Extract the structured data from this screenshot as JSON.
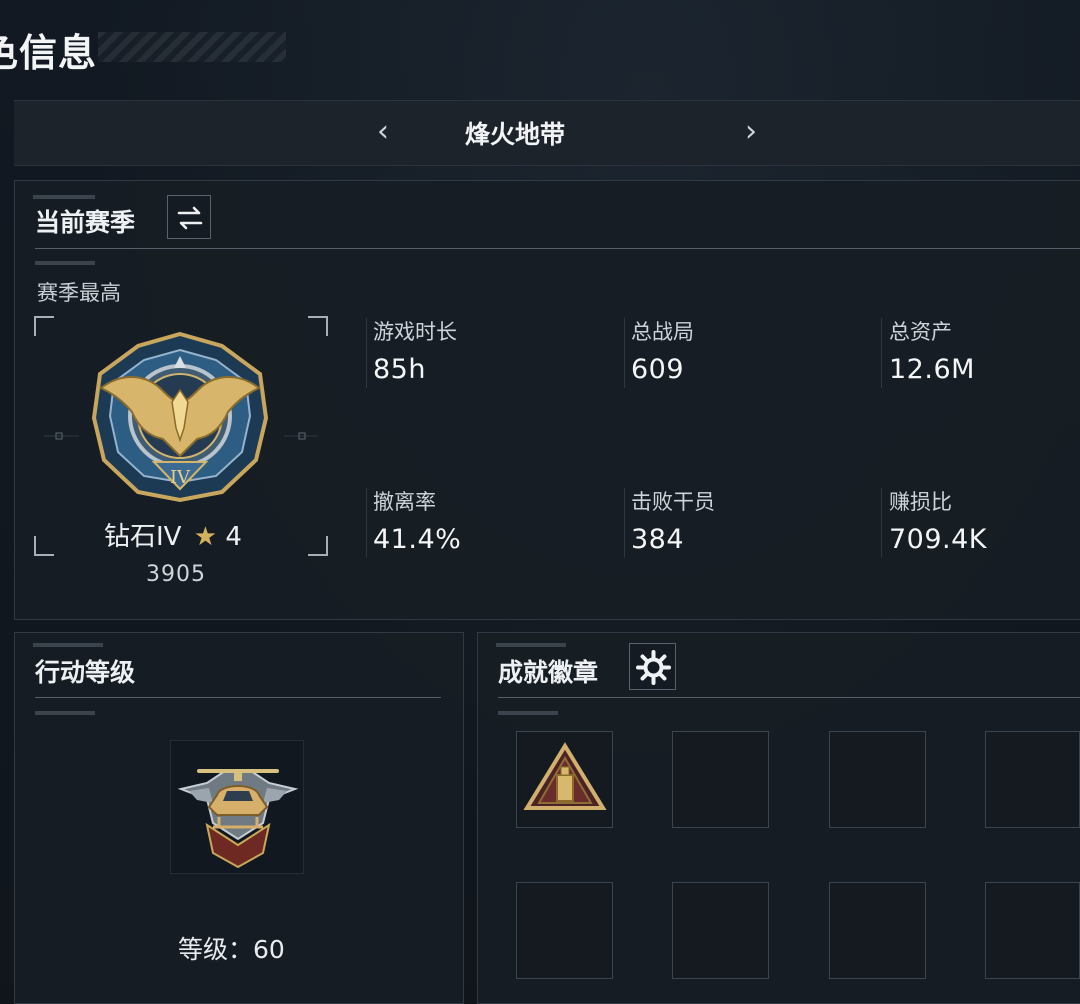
{
  "header": {
    "title": "色信息"
  },
  "game_switcher": {
    "prev_icon": "chevron-left-icon",
    "title": "烽火地带",
    "next_icon": "chevron-right-icon"
  },
  "season_panel": {
    "title": "当前赛季",
    "switch_icon": "swap-arrows-icon",
    "subtitle": "赛季最高",
    "rank": {
      "name": "钻石IV",
      "stars": "4",
      "score": "3905",
      "emblem_icon": "diamond-rank-eagle-icon"
    },
    "stats": [
      {
        "label": "游戏时长",
        "value": "85h"
      },
      {
        "label": "总战局",
        "value": "609"
      },
      {
        "label": "总资产",
        "value": "12.6M"
      },
      {
        "label": "撤离率",
        "value": "41.4%"
      },
      {
        "label": "击败干员",
        "value": "384"
      },
      {
        "label": "赚损比",
        "value": "709.4K"
      }
    ]
  },
  "operation_panel": {
    "title": "行动等级",
    "emblem_icon": "helicopter-emblem-icon",
    "level_label": "等级：",
    "level_value": "60"
  },
  "achievement_panel": {
    "title": "成就徽章",
    "settings_icon": "gear-icon",
    "first_badge_icon": "triangle-badge-icon"
  },
  "colors": {
    "background": "#10151b",
    "panel": "#171d24",
    "border": "#313a44",
    "accent_gold": "#c9a85b",
    "accent_blue": "#4f86b3"
  }
}
